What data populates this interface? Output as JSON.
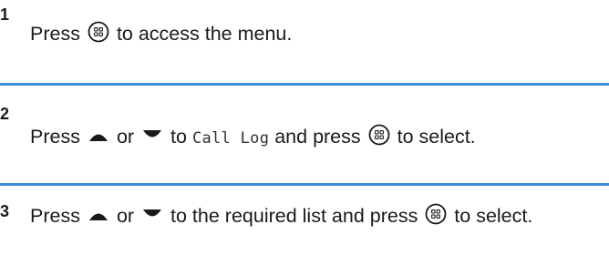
{
  "steps": [
    {
      "number": "1",
      "press": "Press",
      "after_ok": "to access the menu."
    },
    {
      "number": "2",
      "press": "Press",
      "or": "or",
      "to": "to",
      "menu_item": "Call Log",
      "and_press": "and press",
      "after_ok": "to select."
    },
    {
      "number": "3",
      "press": "Press",
      "or": "or",
      "to_list": "to the required list and press",
      "after_ok": "to select."
    }
  ],
  "icons": {
    "ok_button": "menu-ok-button-icon",
    "up_arrow": "up-arrow-icon",
    "down_arrow": "down-arrow-icon"
  },
  "colors": {
    "divider": "#3f8bd8",
    "text": "#1a1a1a"
  }
}
